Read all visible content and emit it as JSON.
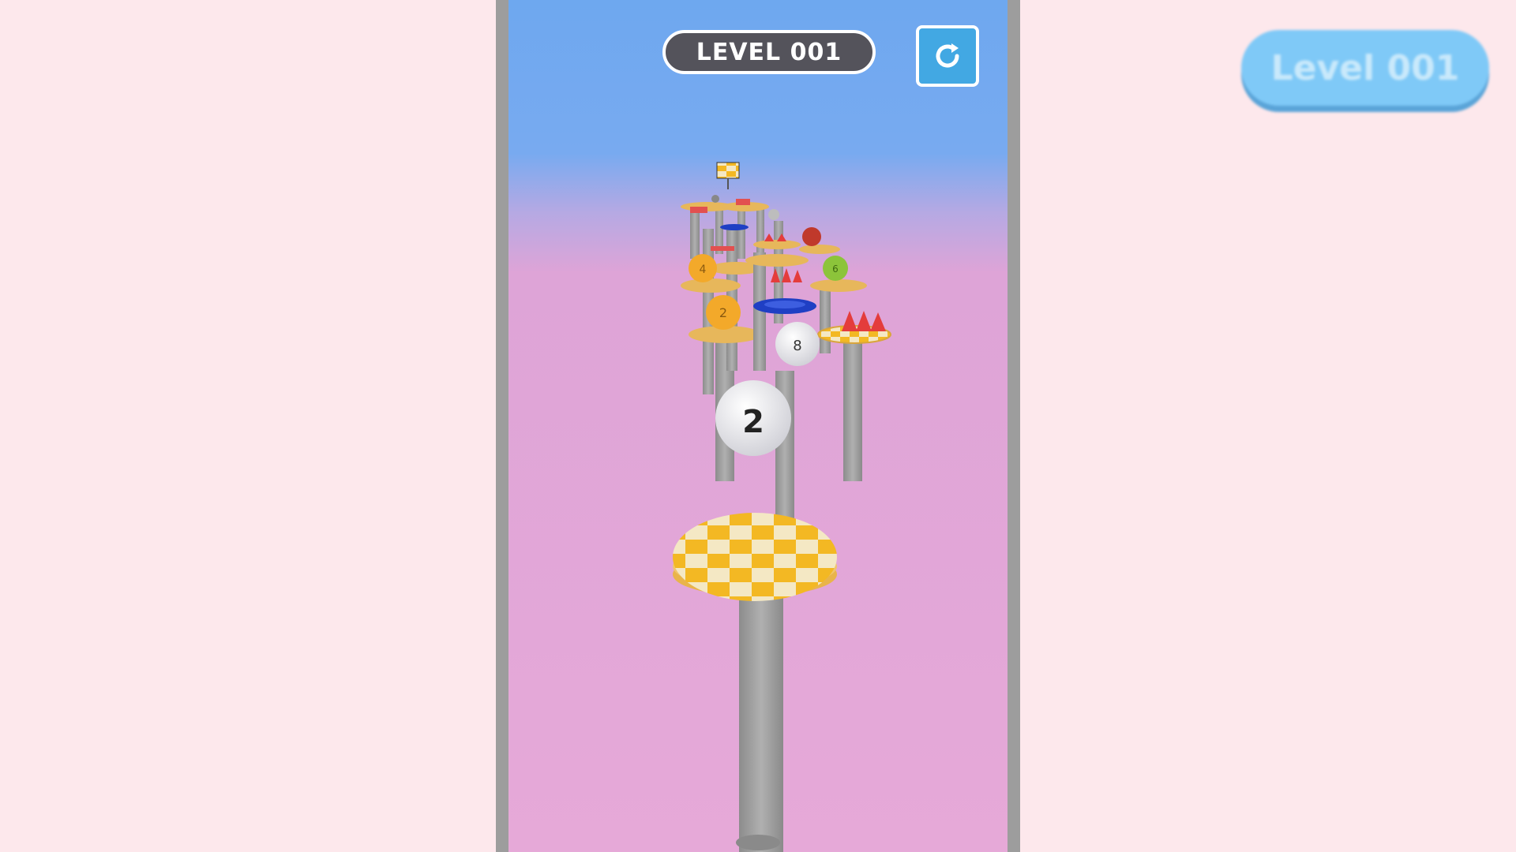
{
  "hud": {
    "level_label": "LEVEL 001"
  },
  "corner_badge": {
    "label": "Level 001"
  },
  "player_ball": {
    "number": "2"
  },
  "colors": {
    "sky": "#6ea8ef",
    "ground_haze": "#e6a9d8",
    "tile_yellow": "#f3b823",
    "tile_cream": "#f4e8c4",
    "pillar": "#9d9d9d",
    "spike": "#e43c3c",
    "ring_blue": "#1f3fc4",
    "restart_button": "#42a8e3",
    "badge_blue": "#7fc9f7"
  },
  "icons": {
    "restart": "restart-icon",
    "finish": "checkered-flag-icon"
  }
}
